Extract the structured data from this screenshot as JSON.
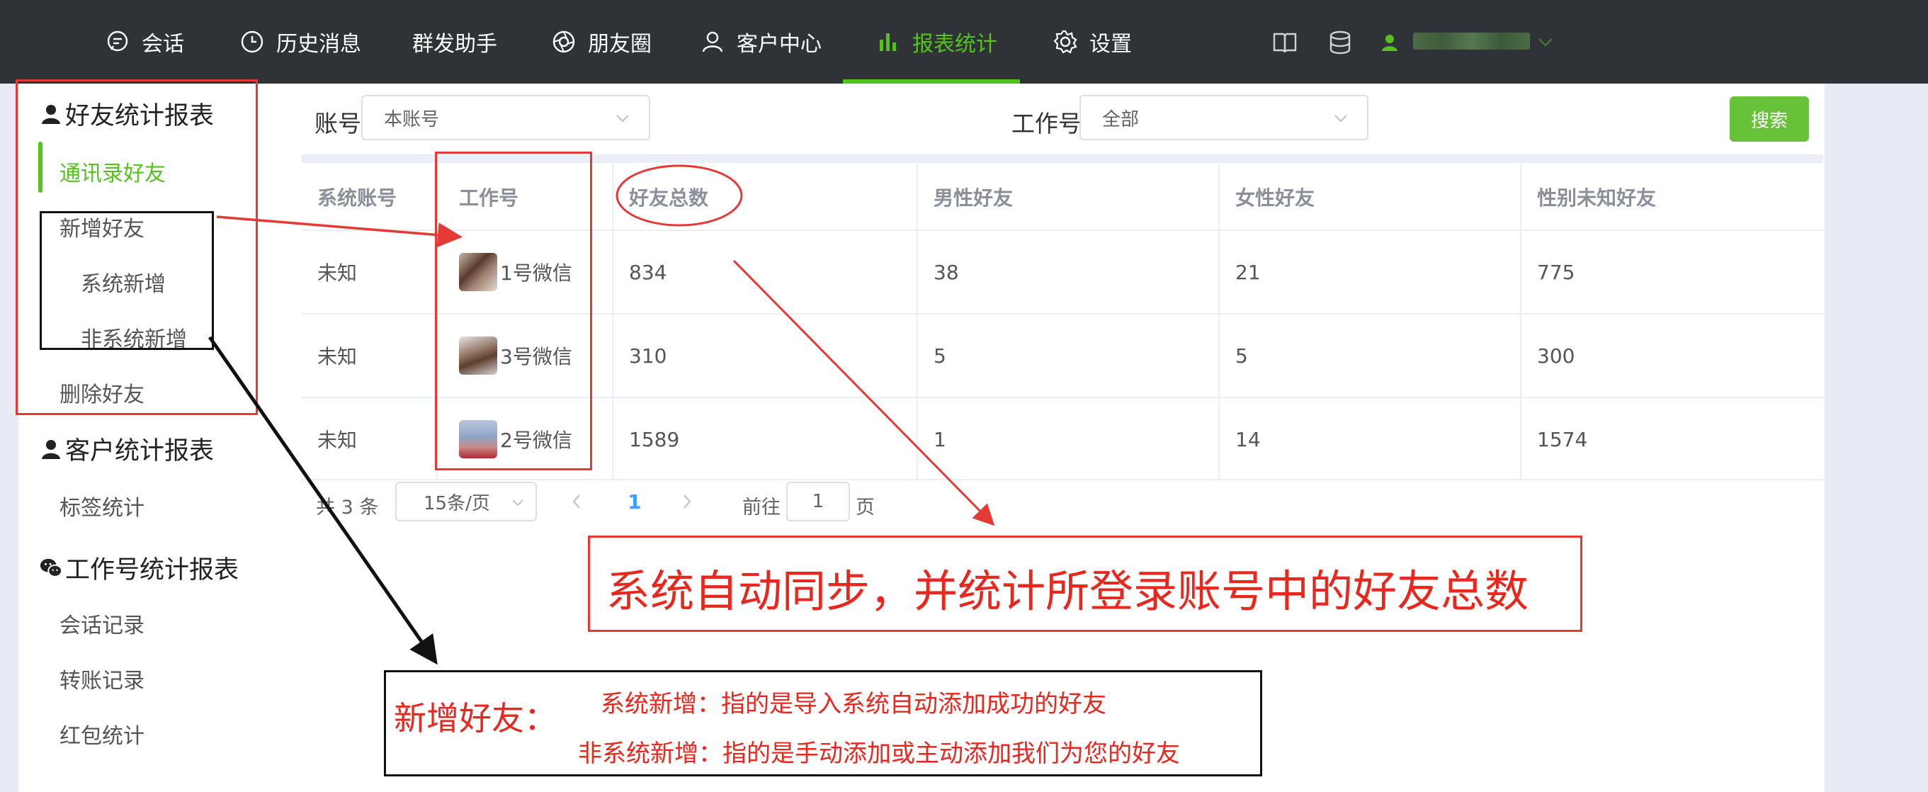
{
  "nav": {
    "items": [
      {
        "label": "会话",
        "icon": "chat-icon"
      },
      {
        "label": "历史消息",
        "icon": "clock-icon"
      },
      {
        "label": "群发助手",
        "icon": ""
      },
      {
        "label": "朋友圈",
        "icon": "aperture-icon"
      },
      {
        "label": "客户中心",
        "icon": "user-icon"
      },
      {
        "label": "报表统计",
        "icon": "bar-chart-icon",
        "active": true
      },
      {
        "label": "设置",
        "icon": "gear-icon"
      }
    ],
    "accent": "#52c41a"
  },
  "sidebar": {
    "groups": [
      {
        "label": "好友统计报表",
        "icon": "user-icon"
      },
      {
        "label": "客户统计报表",
        "icon": "user-icon"
      },
      {
        "label": "工作号统计报表",
        "icon": "wechat-icon"
      }
    ],
    "items": [
      {
        "label": "通讯录好友",
        "active": true
      },
      {
        "label": "新增好友"
      },
      {
        "label": "系统新增"
      },
      {
        "label": "非系统新增"
      },
      {
        "label": "删除好友"
      },
      {
        "label": "标签统计"
      },
      {
        "label": "会话记录"
      },
      {
        "label": "转账记录"
      },
      {
        "label": "红包统计"
      }
    ]
  },
  "filters": {
    "account_label": "账号",
    "account_value": "本账号",
    "worknum_label": "工作号",
    "worknum_value": "全部",
    "search_label": "搜索"
  },
  "table": {
    "headers": [
      "系统账号",
      "工作号",
      "好友总数",
      "男性好友",
      "女性好友",
      "性别未知好友"
    ],
    "rows": [
      [
        "未知",
        "1号微信",
        "834",
        "38",
        "21",
        "775"
      ],
      [
        "未知",
        "3号微信",
        "310",
        "5",
        "5",
        "300"
      ],
      [
        "未知",
        "2号微信",
        "1589",
        "1",
        "14",
        "1574"
      ]
    ]
  },
  "pagination": {
    "total": "共 3 条",
    "page_size": "15条/页",
    "current": "1",
    "goto_label": "前往",
    "goto_value": "1",
    "page_unit": "页"
  },
  "annotations": {
    "sync_note": "系统自动同步，并统计所登录账号中的好友总数",
    "new_friend_title": "新增好友：",
    "system_new_desc": "系统新增：指的是导入系统自动添加成功的好友",
    "non_system_new_desc": "非系统新增：指的是手动添加或主动添加我们为您的好友"
  }
}
